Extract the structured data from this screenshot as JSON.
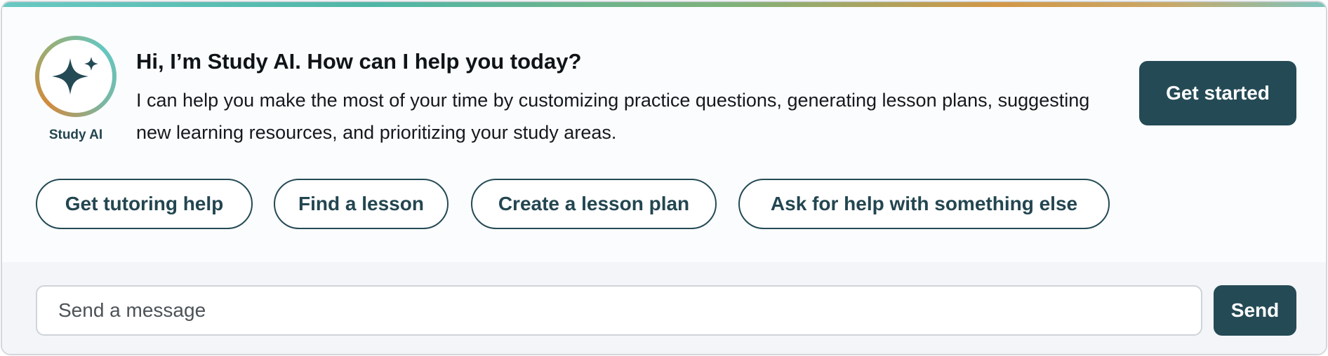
{
  "assistant": {
    "name": "Study AI",
    "icon": "sparkles-icon"
  },
  "greeting": "Hi, I’m Study AI. How can I help you today?",
  "description": "I can help you make the most of your time by customizing practice questions, generating lesson plans, suggesting new learning resources, and prioritizing your study areas.",
  "get_started_label": "Get started",
  "suggestions": [
    "Get tutoring help",
    "Find a lesson",
    "Create a lesson plan",
    "Ask for help with something else"
  ],
  "composer": {
    "placeholder": "Send a message",
    "value": "",
    "send_label": "Send"
  },
  "colors": {
    "primary": "#244a55",
    "gradient_teal": "#64c7c2",
    "gradient_orange": "#d28a3b"
  }
}
